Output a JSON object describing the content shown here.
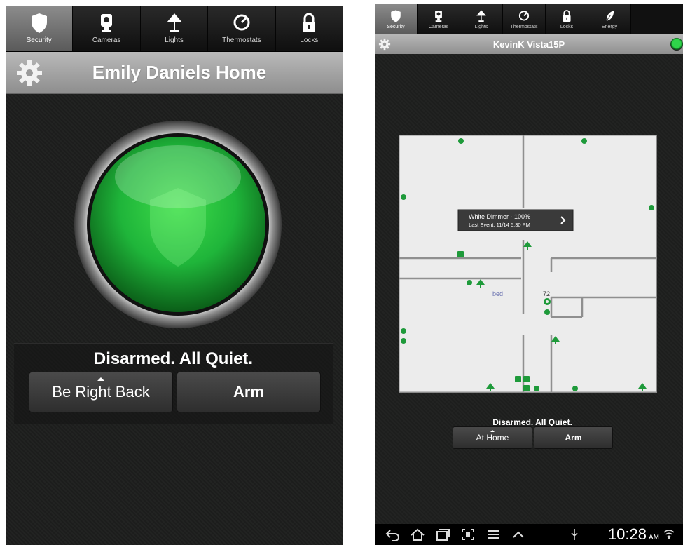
{
  "phone": {
    "tabs": [
      {
        "label": "Security",
        "icon": "shield-icon",
        "active": true
      },
      {
        "label": "Cameras",
        "icon": "camera-icon",
        "active": false
      },
      {
        "label": "Lights",
        "icon": "lamp-icon",
        "active": false
      },
      {
        "label": "Thermostats",
        "icon": "thermostat-icon",
        "active": false
      },
      {
        "label": "Locks",
        "icon": "lock-icon",
        "active": false
      }
    ],
    "title": "Emily Daniels Home",
    "status": "Disarmed. All Quiet.",
    "mode_button": "Be Right Back",
    "arm_button": "Arm"
  },
  "tablet": {
    "tabs": [
      {
        "label": "Security",
        "icon": "shield-icon",
        "active": true
      },
      {
        "label": "Cameras",
        "icon": "camera-icon",
        "active": false
      },
      {
        "label": "Lights",
        "icon": "lamp-icon",
        "active": false
      },
      {
        "label": "Thermostats",
        "icon": "thermostat-icon",
        "active": false
      },
      {
        "label": "Locks",
        "icon": "lock-icon",
        "active": false
      },
      {
        "label": "Energy",
        "icon": "leaf-icon",
        "active": false
      }
    ],
    "title": "KevinK Vista15P",
    "floorplan": {
      "popup_title": "White Dimmer - 100%",
      "popup_subtitle": "Last Event: 11/14 5:30 PM",
      "room_label": "bed",
      "temp_label": "72"
    },
    "status": "Disarmed. All Quiet.",
    "mode_button": "At Home",
    "arm_button": "Arm",
    "time": "10:28",
    "ampm": "AM"
  },
  "colors": {
    "accent_green": "#1fb53a",
    "device_green": "#1e9a3a",
    "tab_active": "#7a7a7a",
    "title_bar": "#a3a3a3"
  }
}
